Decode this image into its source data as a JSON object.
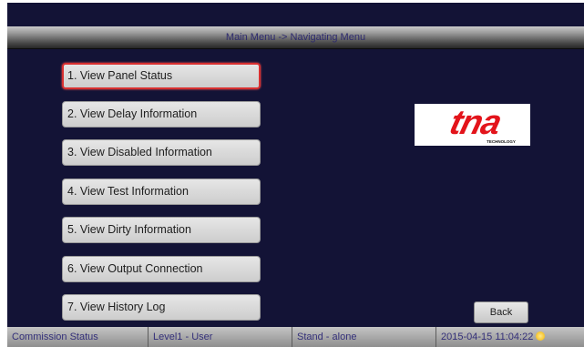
{
  "header": {
    "title": "Main Menu -> Navigating Menu"
  },
  "menu": {
    "items": [
      {
        "label": "1. View Panel Status"
      },
      {
        "label": "2. View Delay Information"
      },
      {
        "label": "3. View Disabled Information"
      },
      {
        "label": "4. View Test Information"
      },
      {
        "label": "5. View Dirty Information"
      },
      {
        "label": "6. View Output Connection"
      },
      {
        "label": "7. View History Log"
      }
    ],
    "selected_index": 0
  },
  "logo": {
    "text": "tna",
    "subtext": "TECHNOLOGY",
    "color": "#e3141b"
  },
  "back": {
    "label": "Back"
  },
  "status": {
    "commission": "Commission Status",
    "level": "Level1 - User",
    "mode": "Stand - alone",
    "datetime": "2015-04-15 11:04:22"
  },
  "colors": {
    "background": "#131336",
    "selected_border": "#d83030"
  }
}
